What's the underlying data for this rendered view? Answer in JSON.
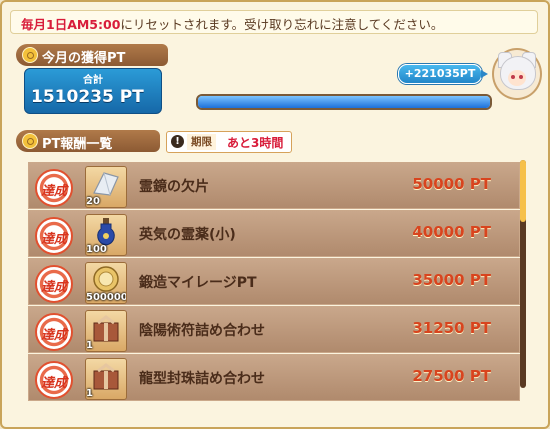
{
  "notice": {
    "highlight": "毎月1日AM5:00",
    "rest": "にリセットされます。受け取り忘れに注意してください。"
  },
  "monthly_section": {
    "title": "今月の獲得PT"
  },
  "total": {
    "caption": "合計",
    "value": "1510235 PT"
  },
  "gain_badge": "+221035PT",
  "progress": {
    "fraction": 1.0,
    "color": "#1c6fd8"
  },
  "rewards_section": {
    "title": "PT報酬一覧"
  },
  "period": {
    "label": "期限",
    "value": "あと3時間"
  },
  "rewards": [
    {
      "status": "達成",
      "icon": "mirror-shard-icon",
      "qty": "20",
      "name": "霊鏡の欠片",
      "pt": "50000 PT"
    },
    {
      "status": "達成",
      "icon": "potion-bottle-icon",
      "qty": "100",
      "name": "英気の霊薬(小)",
      "pt": "40000 PT"
    },
    {
      "status": "達成",
      "icon": "coin-icon",
      "qty": "500000",
      "name": "鍛造マイレージPT",
      "pt": "35000 PT"
    },
    {
      "status": "達成",
      "icon": "gift-box-icon",
      "qty": "1",
      "name": "陰陽術符詰め合わせ",
      "pt": "31250 PT"
    },
    {
      "status": "達成",
      "icon": "gift-box-icon",
      "qty": "1",
      "name": "龍型封珠詰め合わせ",
      "pt": "27500 PT"
    }
  ],
  "colors": {
    "accent_red": "#d81c3a",
    "pt_orange": "#d8441e",
    "panel_brown": "#8c5a33",
    "badge_blue": "#2286c8"
  }
}
